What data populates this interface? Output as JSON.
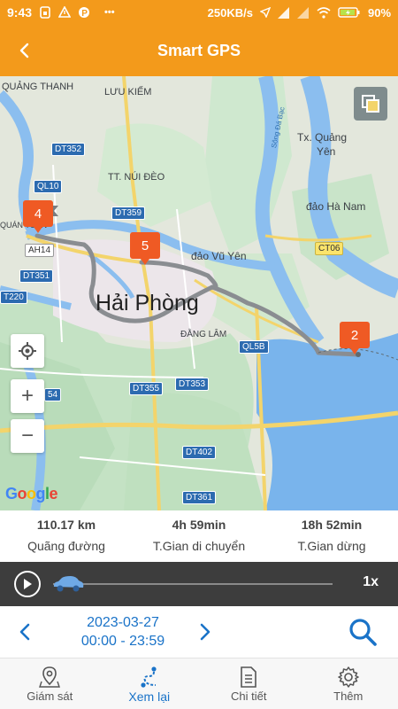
{
  "status_bar": {
    "time": "9:43",
    "network_speed": "250KB/s",
    "battery": "90",
    "battery_unit": "%",
    "more": "•••",
    "left_icons": [
      "sim-icon",
      "card-icon",
      "warning-icon",
      "p-app-icon"
    ],
    "right_icons": [
      "location-arrow-icon",
      "signal-icon",
      "signal-icon",
      "wifi-icon",
      "battery-icon"
    ]
  },
  "header": {
    "title": "Smart GPS",
    "back_icon": "back-chevron-icon"
  },
  "map": {
    "labels": {
      "quang_thanh": "QUẢNG THANH",
      "luu_kiem": "LƯU KIẾM",
      "tx_quang_yen_1": "Tx. Quảng",
      "tx_quang_yen_2": "Yên",
      "song_da_bac": "Sông Đá Bạc",
      "tt_nui_deo": "TT. NÚI ĐÈO",
      "dao_ha_nam": "đảo Hà Nam",
      "quan_toan": "QUÁN TOAN",
      "dao_vu_yen": "đảo Vũ Yên",
      "hai_phong": "Hải Phòng",
      "dang_lam": "ĐẰNG LÂM"
    },
    "road_badges": {
      "dt352": "DT352",
      "ql10": "QL10",
      "dt359": "DT359",
      "ct06": "CT06",
      "ah14": "AH14",
      "dt351": "DT351",
      "t220": "T220",
      "ql5b": "QL5B",
      "dt355": "DT355",
      "dt353": "DT353",
      "b54": "54",
      "dt402": "DT402",
      "dt361": "DT361"
    },
    "markers": [
      {
        "label": "4",
        "color": "#ef5a24"
      },
      {
        "label": "5",
        "color": "#ef5a24"
      },
      {
        "label": "2",
        "color": "#ef5a24"
      }
    ],
    "route_color": "#8a8d91",
    "google_logo": [
      "G",
      "o",
      "o",
      "g",
      "l",
      "e"
    ],
    "google_colors": [
      "#4285F4",
      "#EA4335",
      "#FBBC05",
      "#4285F4",
      "#34A853",
      "#EA4335"
    ],
    "controls": {
      "locate_icon": "crosshair-icon",
      "zoom_in": "+",
      "zoom_out": "−",
      "layers_icon": "layers-icon"
    }
  },
  "stats": [
    {
      "value": "110.17 km",
      "label": "Quãng đường"
    },
    {
      "value": "4h 59min",
      "label": "T.Gian di chuyển"
    },
    {
      "value": "18h 52min",
      "label": "T.Gian dừng"
    }
  ],
  "playback": {
    "play_icon": "play-icon",
    "vehicle_icon": "car-icon",
    "progress": 0,
    "speed": "1x"
  },
  "date_nav": {
    "date": "2023-03-27",
    "time_range": "00:00 - 23:59",
    "prev_icon": "chevron-left-icon",
    "next_icon": "chevron-right-icon",
    "search_icon": "search-icon"
  },
  "bottom_nav": {
    "items": [
      {
        "label": "Giám sát",
        "icon": "map-pin-icon",
        "active": false
      },
      {
        "label": "Xem lại",
        "icon": "route-icon",
        "active": true
      },
      {
        "label": "Chi tiết",
        "icon": "document-icon",
        "active": false
      },
      {
        "label": "Thêm",
        "icon": "gear-icon",
        "active": false
      }
    ]
  },
  "colors": {
    "accent": "#f39a1b",
    "link": "#1a73c8",
    "marker": "#ef5a24",
    "playback_bg": "#3d3d3d"
  }
}
